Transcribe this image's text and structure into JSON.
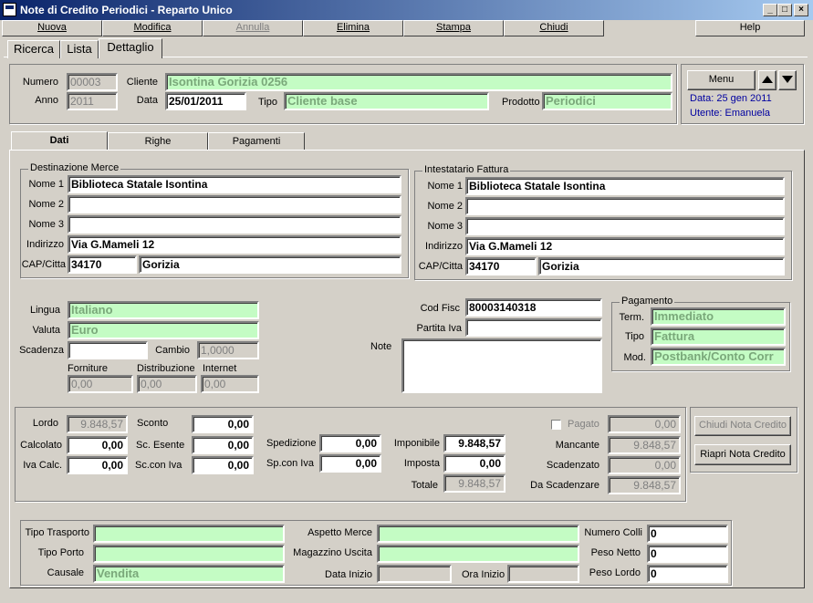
{
  "window": {
    "title": "Note di Credito Periodici - Reparto Unico",
    "min": "_",
    "max": "□",
    "close": "×"
  },
  "menubar": {
    "nuova": "Nuova",
    "modifica": "Modifica",
    "annulla": "Annulla",
    "elimina": "Elimina",
    "stampa": "Stampa",
    "chiudi": "Chiudi",
    "help": "Help"
  },
  "viewtabs": {
    "ricerca": "Ricerca",
    "lista": "Lista",
    "dettaglio": "Dettaglio"
  },
  "header": {
    "numero_label": "Numero",
    "numero": "00003",
    "anno_label": "Anno",
    "anno": "2011",
    "cliente_label": "Cliente",
    "cliente": "Isontina Gorizia 0256",
    "data_label": "Data",
    "data": "25/01/2011",
    "tipo_label": "Tipo",
    "tipo": "Cliente base",
    "prodotto_label": "Prodotto",
    "prodotto": "Periodici"
  },
  "info": {
    "menu": "Menu",
    "data_info": "Data: 25 gen 2011",
    "utente": "Utente: Emanuela"
  },
  "subtabs": {
    "dati": "Dati",
    "righe": "Righe",
    "pagamenti": "Pagamenti"
  },
  "destinazione": {
    "title": "Destinazione Merce",
    "nome1_label": "Nome 1",
    "nome1": "Biblioteca Statale Isontina",
    "nome2_label": "Nome 2",
    "nome2": "",
    "nome3_label": "Nome 3",
    "nome3": "",
    "indirizzo_label": "Indirizzo",
    "indirizzo": "Via G.Mameli 12",
    "capcitta_label": "CAP/Citta",
    "cap": "34170",
    "citta": "Gorizia"
  },
  "intestatario": {
    "title": "Intestatario Fattura",
    "nome1_label": "Nome 1",
    "nome1": "Biblioteca Statale Isontina",
    "nome2_label": "Nome 2",
    "nome2": "",
    "nome3_label": "Nome 3",
    "nome3": "",
    "indirizzo_label": "Indirizzo",
    "indirizzo": "Via G.Mameli 12",
    "capcitta_label": "CAP/Citta",
    "cap": "34170",
    "citta": "Gorizia"
  },
  "misc": {
    "lingua_label": "Lingua",
    "lingua": "Italiano",
    "valuta_label": "Valuta",
    "valuta": "Euro",
    "scadenza_label": "Scadenza",
    "scadenza": "",
    "cambio_label": "Cambio",
    "cambio": "1,0000",
    "forniture_label": "Forniture",
    "forniture": "0,00",
    "distribuzione_label": "Distribuzione",
    "distribuzione": "0,00",
    "internet_label": "Internet",
    "internet": "0,00",
    "codfisc_label": "Cod Fisc",
    "codfisc": "80003140318",
    "partitaiva_label": "Partita Iva",
    "partitaiva": "",
    "note_label": "Note",
    "note": ""
  },
  "pagamento": {
    "title": "Pagamento",
    "term_label": "Term.",
    "term": "Immediato",
    "tipo_label": "Tipo",
    "tipo": "Fattura",
    "mod_label": "Mod.",
    "mod": "Postbank/Conto Corr"
  },
  "totali": {
    "lordo_label": "Lordo",
    "lordo": "9.848,57",
    "calcolato_label": "Calcolato",
    "calcolato": "0,00",
    "ivacalc_label": "Iva Calc.",
    "ivacalc": "0,00",
    "sconto_label": "Sconto",
    "sconto": "0,00",
    "scesente_label": "Sc. Esente",
    "scesente": "0,00",
    "sconiva_label": "Sc.con Iva",
    "sconiva": "0,00",
    "spedizione_label": "Spedizione",
    "spedizione": "0,00",
    "spconiva_label": "Sp.con Iva",
    "spconiva": "0,00",
    "imponibile_label": "Imponibile",
    "imponibile": "9.848,57",
    "imposta_label": "Imposta",
    "imposta": "0,00",
    "totale_label": "Totale",
    "totale": "9.848,57",
    "pagato_label": "Pagato",
    "pagato": "0,00",
    "mancante_label": "Mancante",
    "mancante": "9.848,57",
    "scadenzato_label": "Scadenzato",
    "scadenzato": "0,00",
    "dascadenzare_label": "Da Scadenzare",
    "dascadenzare": "9.848,57"
  },
  "actions": {
    "chiudi_nota": "Chiudi Nota Credito",
    "riapri_nota": "Riapri Nota Credito"
  },
  "trasporto": {
    "tipotrasporto_label": "Tipo Trasporto",
    "tipotrasporto": "",
    "tipoporto_label": "Tipo Porto",
    "tipoporto": "",
    "causale_label": "Causale",
    "causale": "Vendita",
    "aspettomerce_label": "Aspetto Merce",
    "aspettomerce": "",
    "magazzino_label": "Magazzino Uscita",
    "magazzino": "",
    "datainizio_label": "Data Inizio",
    "datainizio": "",
    "orainizio_label": "Ora Inizio",
    "orainizio": "",
    "numerocolli_label": "Numero Colli",
    "numerocolli": "0",
    "pesonetto_label": "Peso Netto",
    "pesonetto": "0",
    "pesolordo_label": "Peso Lordo",
    "pesolordo": "0"
  }
}
